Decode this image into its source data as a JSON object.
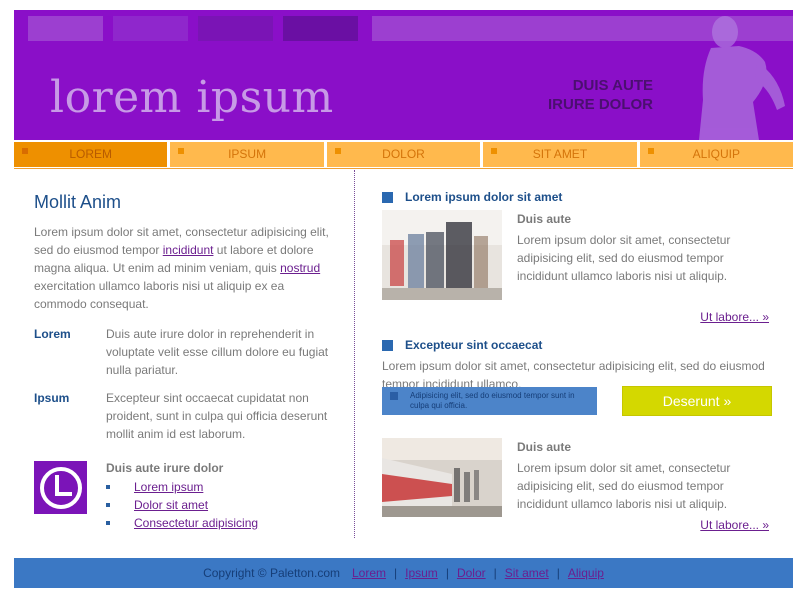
{
  "header": {
    "logo": "lorem ipsum",
    "tagline_line1": "DUIS AUTE",
    "tagline_line2": "IRURE DOLOR",
    "top_blocks": [
      "#9c3fd0",
      "#8f27cc",
      "#7a14b5",
      "#6a0fa3"
    ],
    "color": "#8a0fc8"
  },
  "nav": {
    "items": [
      "LOREM",
      "IPSUM",
      "DOLOR",
      "SIT AMET",
      "ALIQUIP"
    ],
    "active_index": 0
  },
  "left": {
    "title": "Mollit Anim",
    "intro_part1": "Lorem ipsum dolor sit amet, consectetur adipisicing elit, sed do eiusmod tempor",
    "intro_link1": "incididunt",
    "intro_part2": "ut labore et dolore magna aliqua. Ut enim ad minim veniam, quis",
    "intro_link2": "nostrud",
    "intro_part3": "exercitation ullamco laboris nisi ut aliquip ex ea commodo consequat.",
    "defs": [
      {
        "term": "Lorem",
        "desc": "Duis aute irure dolor in reprehenderit in voluptate velit esse cillum dolore eu fugiat nulla pariatur."
      },
      {
        "term": "Ipsum",
        "desc": "Excepteur sint occaecat cupidatat non proident, sunt in culpa qui officia deserunt mollit anim id est laborum."
      }
    ],
    "box": {
      "icon": "clock-icon",
      "title": "Duis aute irure dolor",
      "links": [
        "Lorem ipsum",
        "Dolor sit amet",
        "Consectetur adipisicing"
      ]
    }
  },
  "right": {
    "section1": {
      "heading": "Lorem ipsum dolor sit amet",
      "article_title": "Duis aute",
      "article_text": "Lorem ipsum dolor sit amet, consectetur adipisicing elit, sed do eiusmod tempor incididunt ullamco laboris nisi ut aliquip.",
      "more": "Ut labore... »"
    },
    "section2": {
      "heading": "Excepteur sint occaecat",
      "text": "Lorem ipsum dolor sit amet, consectetur adipisicing elit, sed do eiusmod tempor incididunt ullamco."
    },
    "promo": {
      "note": "Adipisicing elit, sed do eiusmod tempor sunt in culpa qui officia.",
      "cta": "Deserunt »"
    },
    "section3": {
      "article_title": "Duis aute",
      "article_text": "Lorem ipsum dolor sit amet, consectetur adipisicing elit, sed do eiusmod tempor incididunt ullamco laboris nisi ut aliquip.",
      "more": "Ut labore... »"
    }
  },
  "footer": {
    "copyright": "Copyright © Paletton.com",
    "links": [
      "Lorem",
      "Ipsum",
      "Dolor",
      "Sit amet",
      "Aliquip"
    ]
  }
}
